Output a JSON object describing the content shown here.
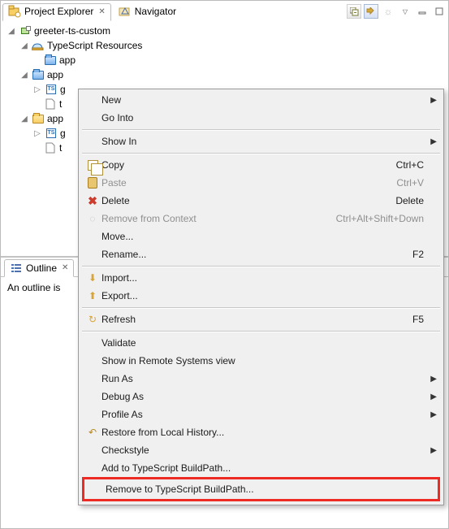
{
  "tabs": {
    "projectExplorer": "Project Explorer",
    "navigator": "Navigator"
  },
  "tree": {
    "project": "greeter-ts-custom",
    "resources": "TypeScript Resources",
    "app": "app",
    "appSourceFolder": "app",
    "tsFile1": "g",
    "plainFile1": "t",
    "appPlainFolder": "app",
    "tsFile2": "g",
    "plainFile2": "t"
  },
  "outline": {
    "title": "Outline",
    "message": "An outline is"
  },
  "menu": {
    "new": "New",
    "goInto": "Go Into",
    "showIn": "Show In",
    "copy": "Copy",
    "copyAccel": "Ctrl+C",
    "paste": "Paste",
    "pasteAccel": "Ctrl+V",
    "delete": "Delete",
    "deleteAccel": "Delete",
    "removeCtx": "Remove from Context",
    "removeCtxAccel": "Ctrl+Alt+Shift+Down",
    "move": "Move...",
    "rename": "Rename...",
    "renameAccel": "F2",
    "import": "Import...",
    "export": "Export...",
    "refresh": "Refresh",
    "refreshAccel": "F5",
    "validate": "Validate",
    "showRemote": "Show in Remote Systems view",
    "runAs": "Run As",
    "debugAs": "Debug As",
    "profileAs": "Profile As",
    "restore": "Restore from Local History...",
    "checkstyle": "Checkstyle",
    "addBuildpath": "Add to TypeScript BuildPath...",
    "removeBuildpath": "Remove to TypeScript BuildPath..."
  }
}
